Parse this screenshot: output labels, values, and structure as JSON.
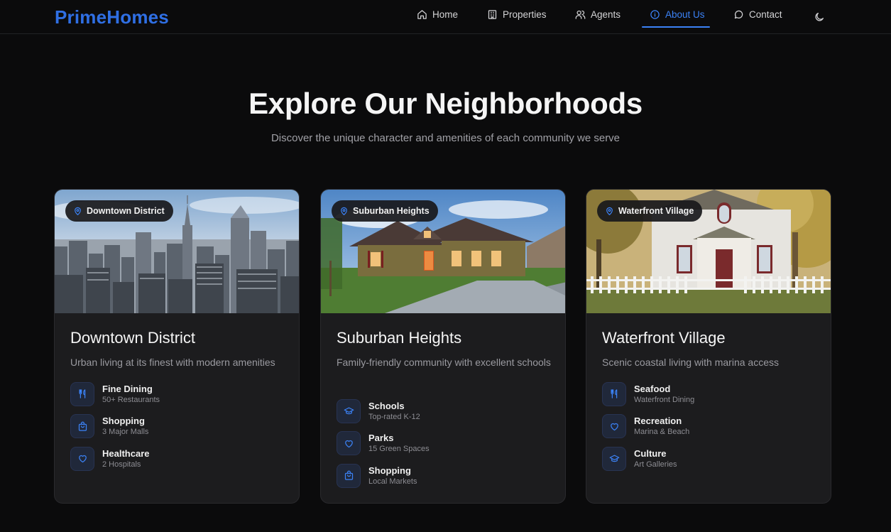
{
  "brand": "PrimeHomes",
  "nav": {
    "items": [
      {
        "label": "Home",
        "icon": "home-icon"
      },
      {
        "label": "Properties",
        "icon": "building-icon"
      },
      {
        "label": "Agents",
        "icon": "users-icon"
      },
      {
        "label": "About Us",
        "icon": "info-icon",
        "active": true
      },
      {
        "label": "Contact",
        "icon": "message-icon"
      }
    ],
    "theme_toggle_icon": "moon-icon"
  },
  "hero": {
    "title": "Explore Our Neighborhoods",
    "subtitle": "Discover the unique character and amenities of each community we serve"
  },
  "neighborhoods": [
    {
      "badge": "Downtown District",
      "title": "Downtown District",
      "description": "Urban living at its finest with modern amenities",
      "features": [
        {
          "title": "Fine Dining",
          "subtitle": "50+ Restaurants",
          "icon": "utensils-icon"
        },
        {
          "title": "Shopping",
          "subtitle": "3 Major Malls",
          "icon": "shopping-bag-icon"
        },
        {
          "title": "Healthcare",
          "subtitle": "2 Hospitals",
          "icon": "heart-icon"
        }
      ]
    },
    {
      "badge": "Suburban Heights",
      "title": "Suburban Heights",
      "description": "Family-friendly community with excellent schools",
      "features": [
        {
          "title": "Schools",
          "subtitle": "Top-rated K-12",
          "icon": "graduation-cap-icon"
        },
        {
          "title": "Parks",
          "subtitle": "15 Green Spaces",
          "icon": "heart-icon"
        },
        {
          "title": "Shopping",
          "subtitle": "Local Markets",
          "icon": "shopping-bag-icon"
        }
      ]
    },
    {
      "badge": "Waterfront Village",
      "title": "Waterfront Village",
      "description": "Scenic coastal living with marina access",
      "features": [
        {
          "title": "Seafood",
          "subtitle": "Waterfront Dining",
          "icon": "utensils-icon"
        },
        {
          "title": "Recreation",
          "subtitle": "Marina & Beach",
          "icon": "heart-icon"
        },
        {
          "title": "Culture",
          "subtitle": "Art Galleries",
          "icon": "graduation-cap-icon"
        }
      ]
    }
  ],
  "colors": {
    "accent": "#3b82f6",
    "brand": "#2f6fe4",
    "background": "#0b0b0c",
    "card": "#1c1c1e"
  }
}
